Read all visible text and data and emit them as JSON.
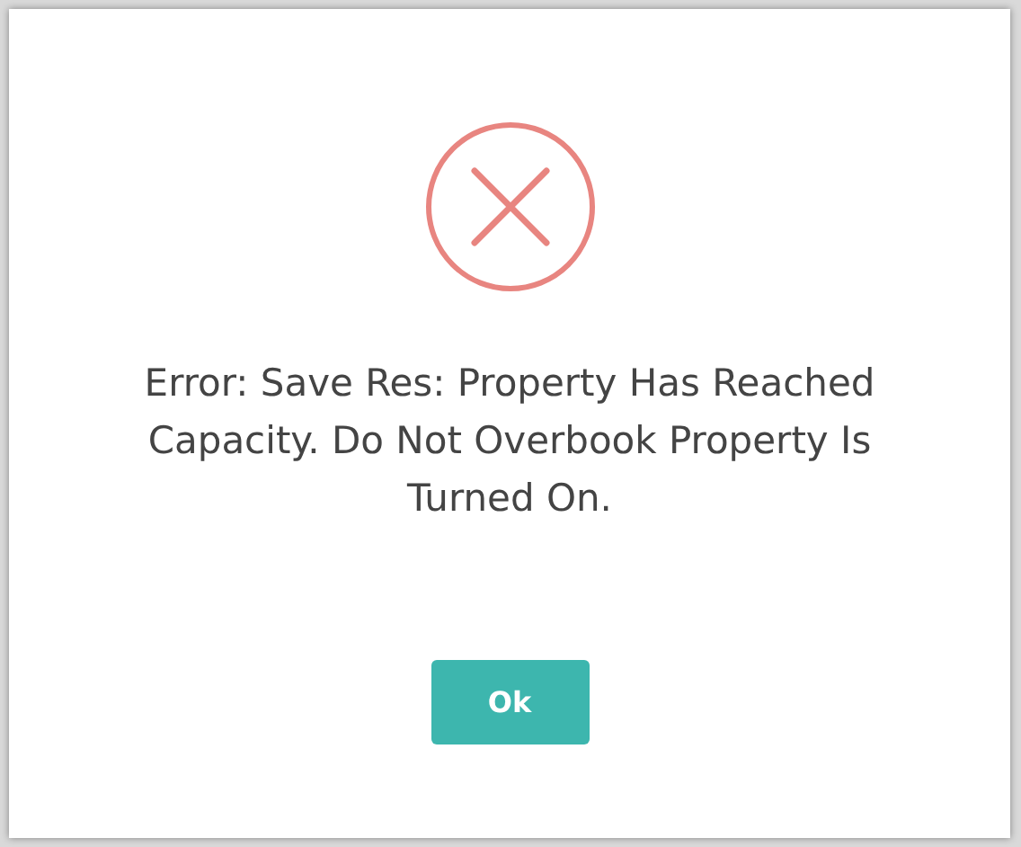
{
  "dialog": {
    "kind": "error",
    "message": "Error: Save Res: Property Has Reached Capacity. Do Not Overbook Property Is Turned On.",
    "buttons": [
      "Ok"
    ]
  }
}
